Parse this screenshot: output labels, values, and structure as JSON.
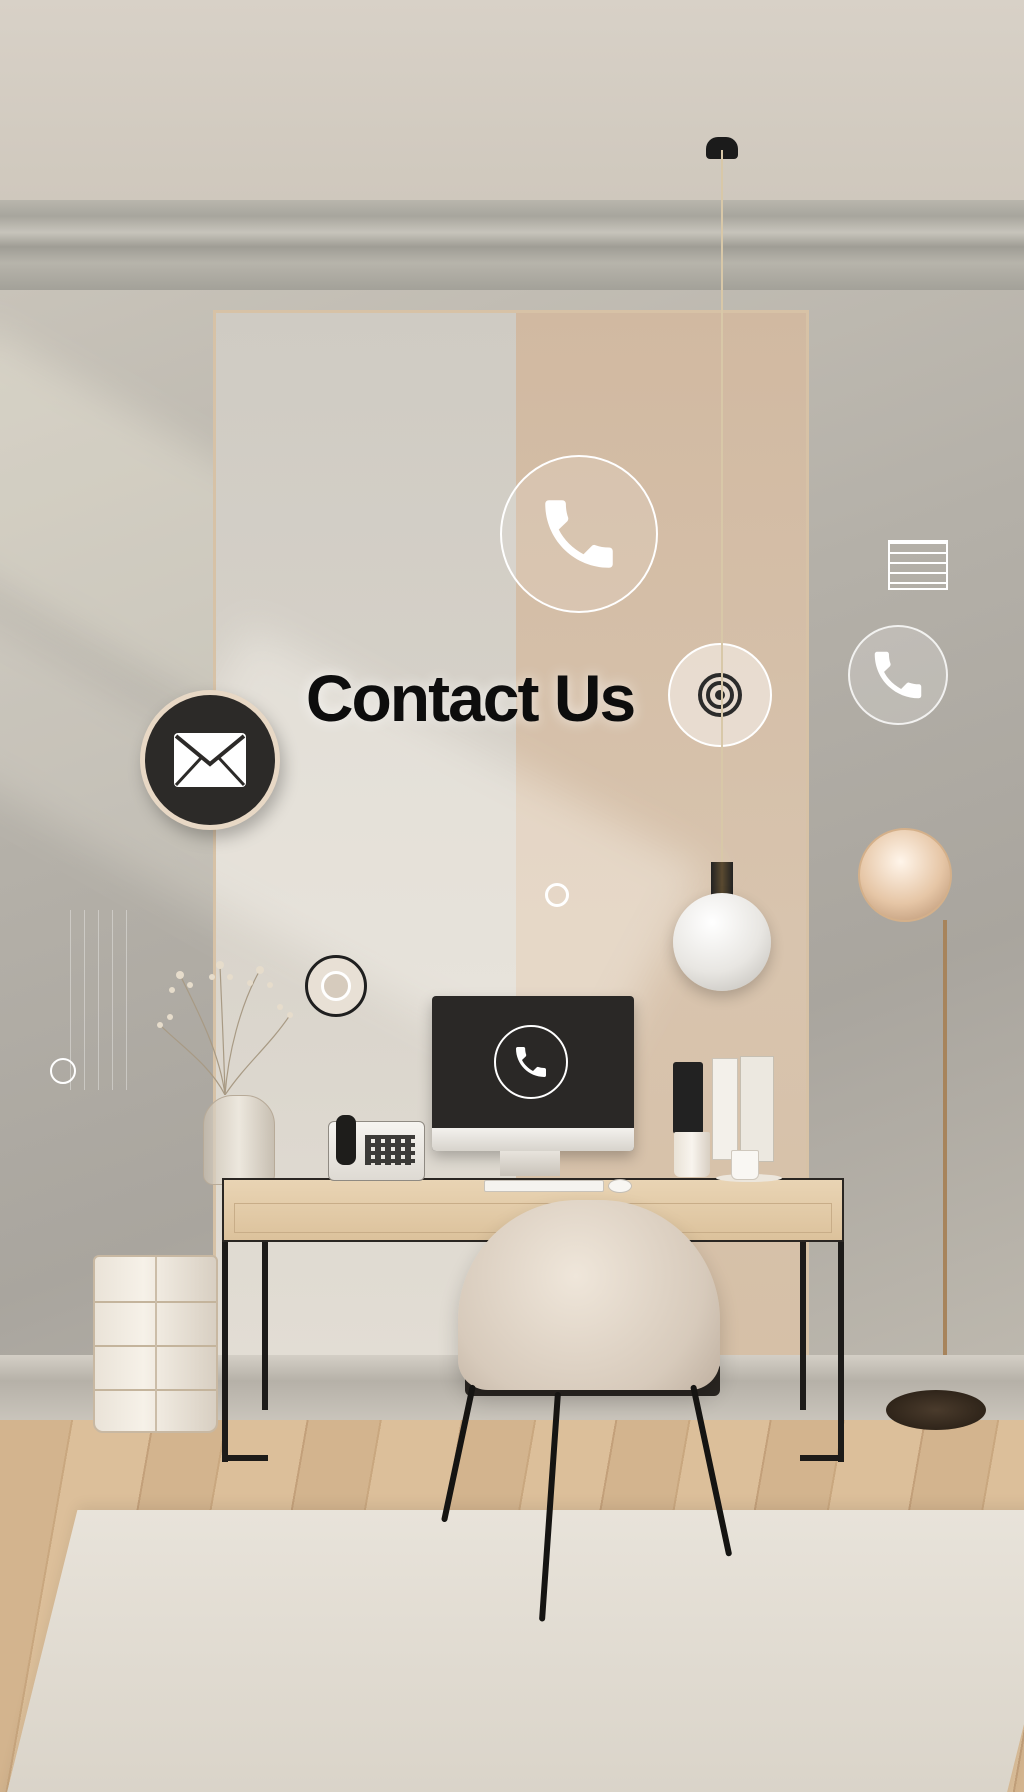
{
  "hero": {
    "title": "Contact Us",
    "blurb_lines": [
      "",
      "",
      ""
    ]
  },
  "icons": {
    "mail": "mail-icon",
    "phone_large": "phone-icon",
    "target": "target-icon",
    "phone_small": "phone-icon",
    "monitor_phone": "phone-icon",
    "grid": "grid-icon"
  },
  "colors": {
    "wall": "#b4b0a8",
    "panel_left": "#d9d4cb",
    "panel_right": "#d8c4ae",
    "title": "#0d0d0d",
    "accent_dark": "#2c2a28",
    "wood": "#dcc29c"
  }
}
